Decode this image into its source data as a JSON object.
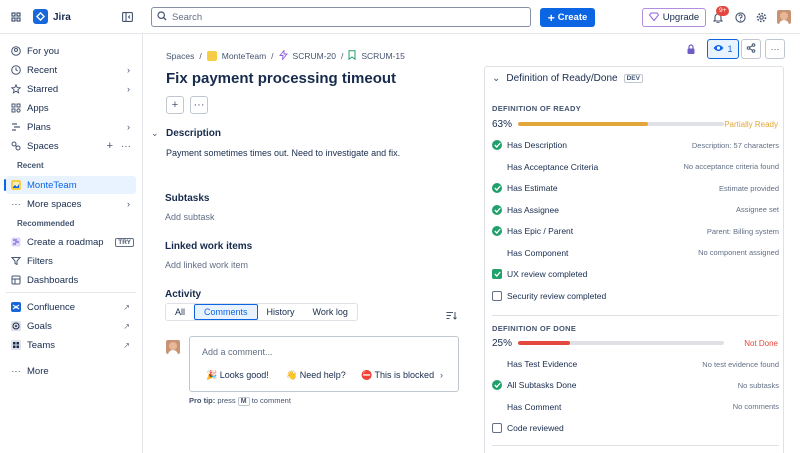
{
  "app": {
    "name": "Jira"
  },
  "search": {
    "placeholder": "Search"
  },
  "header": {
    "create_label": "Create",
    "upgrade_label": "Upgrade",
    "notification_count": "9+"
  },
  "sidebar": {
    "for_you": "For you",
    "recent": "Recent",
    "starred": "Starred",
    "apps": "Apps",
    "plans": "Plans",
    "spaces": "Spaces",
    "recent_heading": "Recent",
    "monteteam": "MonteTeam",
    "more_spaces": "More spaces",
    "recommended_heading": "Recommended",
    "create_roadmap": "Create a roadmap",
    "try_badge": "TRY",
    "filters": "Filters",
    "dashboards": "Dashboards",
    "confluence": "Confluence",
    "goals": "Goals",
    "teams": "Teams",
    "more": "More"
  },
  "breadcrumb": {
    "spaces": "Spaces",
    "project": "MonteTeam",
    "parent": "SCRUM-20",
    "issue": "SCRUM-15"
  },
  "issue": {
    "title": "Fix payment processing timeout",
    "description_heading": "Description",
    "description": "Payment sometimes times out. Need to investigate and fix.",
    "subtasks_heading": "Subtasks",
    "add_subtask": "Add subtask",
    "linked_heading": "Linked work items",
    "add_linked": "Add linked work item",
    "activity_heading": "Activity",
    "tabs": [
      "All",
      "Comments",
      "History",
      "Work log"
    ],
    "comment_placeholder": "Add a comment...",
    "quick_replies": [
      "🎉 Looks good!",
      "👋 Need help?",
      "⛔ This is blocked"
    ],
    "protip_prefix": "Pro tip:",
    "protip_press": "press",
    "protip_key": "M",
    "protip_suffix": "to comment"
  },
  "watchers": {
    "count": "1"
  },
  "dod_panel": {
    "title": "Definition of Ready/Done",
    "badge": "DEV",
    "ready": {
      "heading": "DEFINITION OF READY",
      "percent_label": "63%",
      "percent": 63,
      "status": "Partially Ready",
      "color": "#e2a63b",
      "items": [
        {
          "label": "Has Description",
          "detail": "Description: 57 characters",
          "state": "ok"
        },
        {
          "label": "Has Acceptance Criteria",
          "detail": "No acceptance criteria found",
          "state": "none"
        },
        {
          "label": "Has Estimate",
          "detail": "Estimate provided",
          "state": "ok"
        },
        {
          "label": "Has Assignee",
          "detail": "Assignee set",
          "state": "ok"
        },
        {
          "label": "Has Epic / Parent",
          "detail": "Parent: Billing system",
          "state": "ok"
        },
        {
          "label": "Has Component",
          "detail": "No component assigned",
          "state": "none"
        },
        {
          "label": "UX review completed",
          "detail": "",
          "state": "checked"
        },
        {
          "label": "Security review completed",
          "detail": "",
          "state": "unchecked"
        }
      ]
    },
    "done": {
      "heading": "DEFINITION OF DONE",
      "percent_label": "25%",
      "percent": 25,
      "status": "Not Done",
      "color": "#e2483d",
      "items": [
        {
          "label": "Has Test Evidence",
          "detail": "No test evidence found",
          "state": "none"
        },
        {
          "label": "All Subtasks Done",
          "detail": "No subtasks",
          "state": "ok"
        },
        {
          "label": "Has Comment",
          "detail": "No comments",
          "state": "none"
        },
        {
          "label": "Code reviewed",
          "detail": "",
          "state": "unchecked"
        }
      ]
    }
  }
}
